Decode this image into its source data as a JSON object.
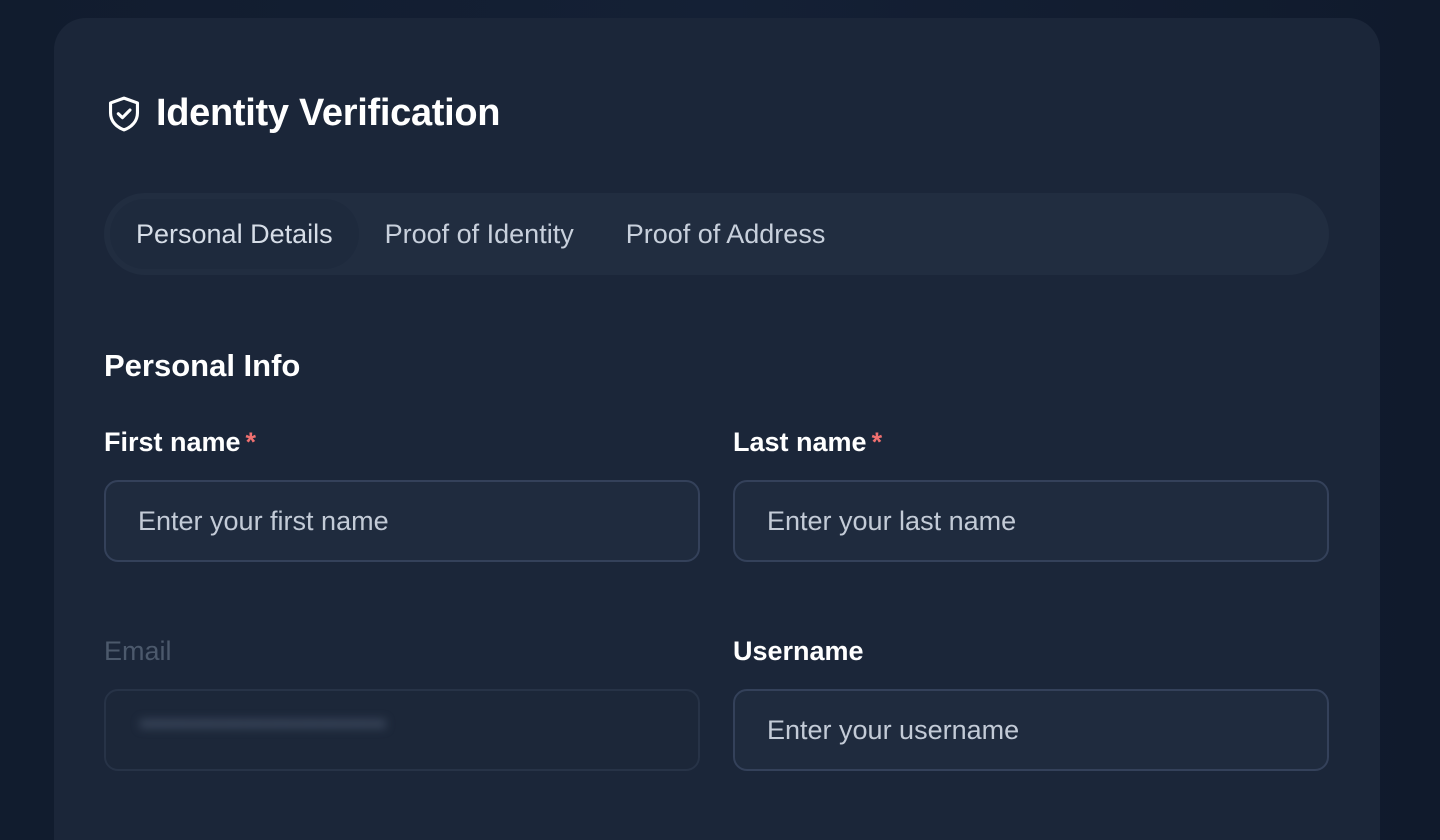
{
  "header": {
    "title": "Identity Verification",
    "icon": "shield-check-icon"
  },
  "tabs": [
    {
      "label": "Personal Details",
      "active": true
    },
    {
      "label": "Proof of Identity",
      "active": false
    },
    {
      "label": "Proof of Address",
      "active": false
    }
  ],
  "section": {
    "title": "Personal Info"
  },
  "fields": {
    "first_name": {
      "label": "First name",
      "required_mark": "*",
      "placeholder": "Enter your first name",
      "value": ""
    },
    "last_name": {
      "label": "Last name",
      "required_mark": "*",
      "placeholder": "Enter your last name",
      "value": ""
    },
    "email": {
      "label": "Email",
      "disabled": true
    },
    "username": {
      "label": "Username",
      "placeholder": "Enter your username",
      "value": ""
    }
  },
  "colors": {
    "background": "#111c2e",
    "card": "#1b2639",
    "tab_bar": "#212d40",
    "input_border": "#34415a",
    "required": "#f07070",
    "text": "#ffffff",
    "muted_label": "#4c596c"
  }
}
